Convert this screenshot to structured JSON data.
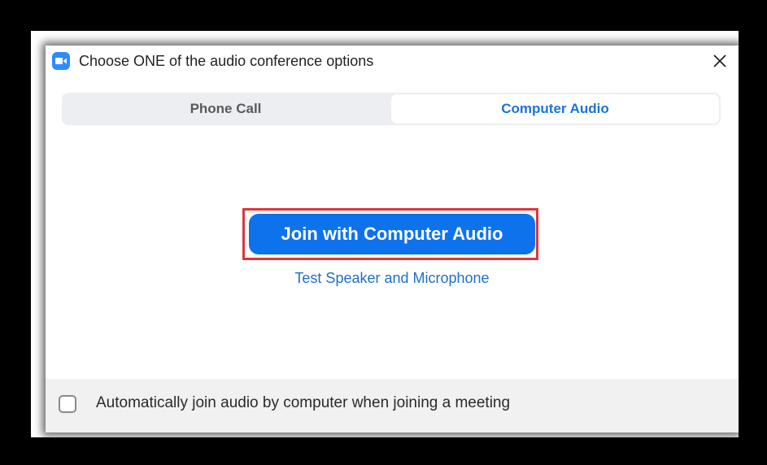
{
  "dialog": {
    "title": "Choose ONE of the audio conference options",
    "app_icon": "video-camera-icon",
    "close_icon": "close-icon"
  },
  "tabs": [
    {
      "label": "Phone Call",
      "selected": false
    },
    {
      "label": "Computer Audio",
      "selected": true
    }
  ],
  "main": {
    "join_button_label": "Join with Computer Audio",
    "test_link_label": "Test Speaker and Microphone"
  },
  "footer": {
    "checkbox_label": "Automatically join audio by computer when joining a meeting",
    "checkbox_checked": false
  },
  "colors": {
    "accent": "#0e72ed",
    "link": "#1f6fc9",
    "highlight": "#e0353a"
  }
}
